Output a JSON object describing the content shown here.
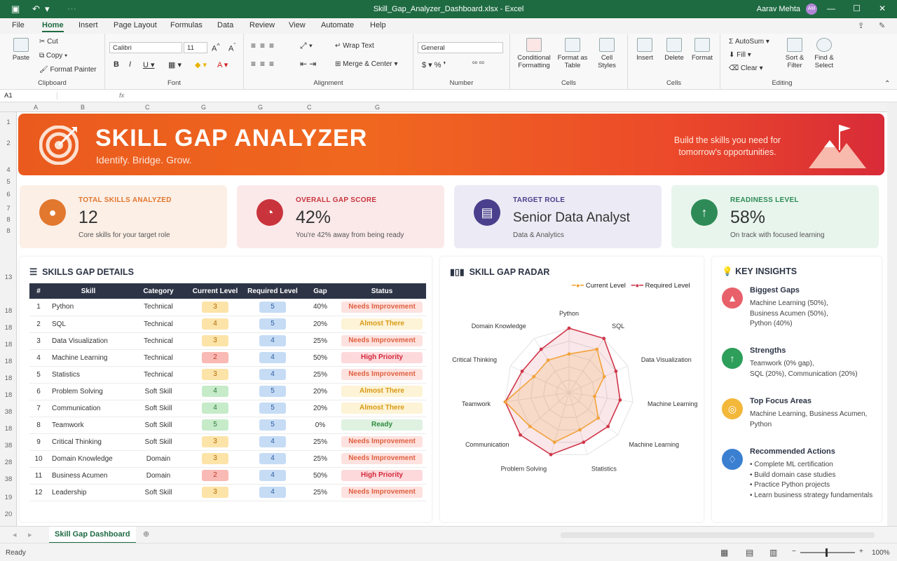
{
  "window": {
    "title": "Skill_Gap_Analyzer_Dashboard.xlsx - Excel",
    "user": "Aarav Mehta",
    "user_initials": "AM"
  },
  "menu": {
    "tabs": [
      "File",
      "Home",
      "Insert",
      "Page Layout",
      "Formulas",
      "Data",
      "Review",
      "View",
      "Automate",
      "Help"
    ],
    "active": "Home"
  },
  "ribbon": {
    "clipboard": {
      "label": "Clipboard",
      "paste": "Paste",
      "cut": "Cut",
      "copy": "Copy",
      "format_painter": "Format Painter"
    },
    "font": {
      "label": "Font",
      "name": "Calibri",
      "size": "11"
    },
    "alignment": {
      "label": "Alignment",
      "wrap": "Wrap Text",
      "merge": "Merge & Center"
    },
    "number": {
      "label": "Number",
      "format": "General"
    },
    "styles": {
      "cond": "Conditional Formatting",
      "table": "Format as Table",
      "cell": "Cell Styles"
    },
    "cells": {
      "label": "Cells",
      "insert": "Insert",
      "delete": "Delete",
      "format": "Format"
    },
    "editing": {
      "label": "Editing",
      "autosum": "AutoSum",
      "fill": "Fill",
      "clear": "Clear",
      "sort": "Sort & Filter",
      "find": "Find & Select"
    }
  },
  "formula_bar": {
    "name_box": "A1",
    "fx": "fx",
    "content": ""
  },
  "columns": [
    "A",
    "B",
    "C",
    "G",
    "G",
    "C",
    "G"
  ],
  "rows": [
    "1",
    "2",
    "4",
    "5",
    "6",
    "7",
    "8",
    "8",
    "13",
    "18",
    "18",
    "18",
    "18",
    "18",
    "18",
    "38",
    "18",
    "38",
    "28",
    "38",
    "19",
    "20"
  ],
  "banner": {
    "title": "SKILL GAP ANALYZER",
    "subtitle": "Identify. Bridge. Grow.",
    "tagline": "Build the skills you need for tomorrow's opportunities."
  },
  "kpis": [
    {
      "label": "TOTAL SKILLS ANALYZED",
      "value": "12",
      "note": "Core skills for your target role",
      "color": "#e2772e",
      "bg": "#fcefe6",
      "icon": "person-icon"
    },
    {
      "label": "OVERALL GAP SCORE",
      "value": "42%",
      "note": "You're 42% away from being ready",
      "color": "#c9343c",
      "bg": "#fbe9ea",
      "icon": "gauge-icon"
    },
    {
      "label": "TARGET ROLE",
      "value": "Senior Data Analyst",
      "note": "Data & Analytics",
      "color": "#4a3f8c",
      "bg": "#ecebf5",
      "icon": "briefcase-icon"
    },
    {
      "label": "READINESS LEVEL",
      "value": "58%",
      "note": "On track with focused learning",
      "color": "#2e8b57",
      "bg": "#e8f5ec",
      "icon": "arrow-up-icon"
    }
  ],
  "skills_table": {
    "title": "SKILLS GAP DETAILS",
    "headers": [
      "#",
      "Skill",
      "Category",
      "Current Level",
      "Required Level",
      "Gap",
      "Status"
    ],
    "rows": [
      {
        "n": "1",
        "skill": "Python",
        "cat": "Technical",
        "cur": "3",
        "req": "5",
        "gap": "40%",
        "status": "Needs Improvement",
        "cc": "y",
        "sc": "ni"
      },
      {
        "n": "2",
        "skill": "SQL",
        "cat": "Technical",
        "cur": "4",
        "req": "5",
        "gap": "20%",
        "status": "Almost There",
        "cc": "y",
        "sc": "at"
      },
      {
        "n": "3",
        "skill": "Data Visualization",
        "cat": "Technical",
        "cur": "3",
        "req": "4",
        "gap": "25%",
        "status": "Needs Improvement",
        "cc": "y",
        "sc": "ni"
      },
      {
        "n": "4",
        "skill": "Machine Learning",
        "cat": "Technical",
        "cur": "2",
        "req": "4",
        "gap": "50%",
        "status": "High Priority",
        "cc": "r",
        "sc": "hp"
      },
      {
        "n": "5",
        "skill": "Statistics",
        "cat": "Technical",
        "cur": "3",
        "req": "4",
        "gap": "25%",
        "status": "Needs Improvement",
        "cc": "y",
        "sc": "ni"
      },
      {
        "n": "6",
        "skill": "Problem Solving",
        "cat": "Soft Skill",
        "cur": "4",
        "req": "5",
        "gap": "20%",
        "status": "Almost There",
        "cc": "g",
        "sc": "at"
      },
      {
        "n": "7",
        "skill": "Communication",
        "cat": "Soft Skill",
        "cur": "4",
        "req": "5",
        "gap": "20%",
        "status": "Almost There",
        "cc": "g",
        "sc": "at"
      },
      {
        "n": "8",
        "skill": "Teamwork",
        "cat": "Soft Skill",
        "cur": "5",
        "req": "5",
        "gap": "0%",
        "status": "Ready",
        "cc": "g",
        "sc": "rd"
      },
      {
        "n": "9",
        "skill": "Critical Thinking",
        "cat": "Soft Skill",
        "cur": "3",
        "req": "4",
        "gap": "25%",
        "status": "Needs Improvement",
        "cc": "y",
        "sc": "ni"
      },
      {
        "n": "10",
        "skill": "Domain Knowledge",
        "cat": "Domain",
        "cur": "3",
        "req": "4",
        "gap": "25%",
        "status": "Needs Improvement",
        "cc": "y",
        "sc": "ni"
      },
      {
        "n": "11",
        "skill": "Business Acumen",
        "cat": "Domain",
        "cur": "2",
        "req": "4",
        "gap": "50%",
        "status": "High Priority",
        "cc": "r",
        "sc": "hp"
      },
      {
        "n": "12",
        "skill": "Leadership",
        "cat": "Soft Skill",
        "cur": "3",
        "req": "4",
        "gap": "25%",
        "status": "Needs Improvement",
        "cc": "y",
        "sc": "ni"
      }
    ]
  },
  "radar": {
    "title": "SKILL GAP RADAR",
    "legend": [
      "Current Level",
      "Required Level"
    ],
    "axes": [
      "Python",
      "SQL",
      "Data Visualization",
      "Machine Learning",
      "Machine Learning",
      "Statistics",
      "Problem Solving",
      "Communication",
      "Teamwork",
      "Critical Thinking",
      "Domain Knowledge"
    ],
    "current": [
      3,
      4,
      3,
      2,
      3,
      3,
      4,
      4,
      5,
      3,
      3
    ],
    "required": [
      5,
      5,
      4,
      4,
      4,
      4,
      5,
      5,
      5,
      4,
      4
    ],
    "max": 5,
    "colors": {
      "current": "#f2a33a",
      "required": "#d0364a"
    }
  },
  "insights": {
    "title": "KEY INSIGHTS",
    "items": [
      {
        "h": "Biggest Gaps",
        "t": [
          "Machine Learning (50%),",
          "Business Acumen (50%),",
          "Python (40%)"
        ],
        "color": "#e8606a",
        "icon": "warning-icon"
      },
      {
        "h": "Strengths",
        "t": [
          "Teamwork (0% gap),",
          "SQL (20%), Communication (20%)"
        ],
        "color": "#2e9e5b",
        "icon": "arrow-up-icon"
      },
      {
        "h": "Top Focus Areas",
        "t": [
          "Machine Learning, Business Acumen,",
          "Python"
        ],
        "color": "#f3b73a",
        "icon": "target-icon"
      },
      {
        "h": "Recommended Actions",
        "t": [
          "• Complete ML certification",
          "• Build domain case studies",
          "• Practice Python projects",
          "• Learn business strategy fundamentals"
        ],
        "color": "#3b7fd1",
        "icon": "lightbulb-icon"
      }
    ]
  },
  "sheet_tab": "Skill Gap Dashboard",
  "status": {
    "ready": "Ready",
    "zoom": "100%"
  }
}
